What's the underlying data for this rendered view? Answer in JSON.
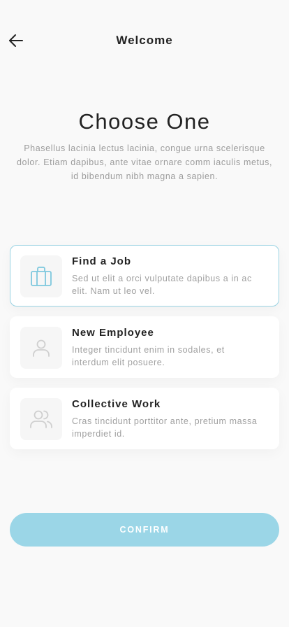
{
  "header": {
    "title": "Welcome",
    "back_icon": "arrow-left-icon"
  },
  "main": {
    "headline": "Choose One",
    "subtitle": "Phasellus lacinia lectus lacinia, congue urna scelerisque dolor. Etiam dapibus, ante vitae ornare comm iaculis metus, id bibendum nibh magna a sapien."
  },
  "options": [
    {
      "title": "Find a Job",
      "description": "Sed ut elit a orci vulputate dapibus a in ac elit. Nam ut leo vel.",
      "icon": "briefcase-icon",
      "selected": true
    },
    {
      "title": "New Employee",
      "description": "Integer tincidunt enim in sodales, et interdum elit posuere.",
      "icon": "user-icon",
      "selected": false
    },
    {
      "title": "Collective Work",
      "description": "Cras tincidunt porttitor ante, pretium massa imperdiet id.",
      "icon": "users-icon",
      "selected": false
    }
  ],
  "confirm": {
    "label": "CONFIRM"
  },
  "colors": {
    "accent": "#9bd6e7",
    "selected_border": "#9ad3e3",
    "selected_icon": "#7ec8de",
    "inactive_icon": "#cfcfcf"
  }
}
